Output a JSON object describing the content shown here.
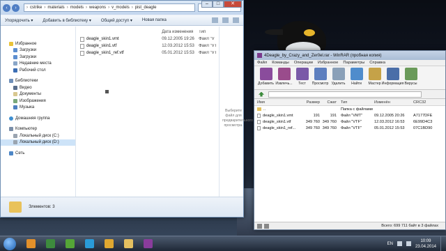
{
  "explorer": {
    "breadcrumb": [
      "cstrike",
      "materials",
      "models",
      "weapons",
      "v_models",
      "pist_deagle"
    ],
    "search_placeholder": "",
    "toolbar": [
      "Упорядочить ▾",
      "Добавить в библиотеку ▾",
      "Общий доступ ▾",
      "Новая папка"
    ],
    "sidebar": {
      "favorites": {
        "label": "Избранное",
        "items": [
          "Загрузки",
          "Загрузки",
          "Недавние места",
          "Рабочий стол"
        ]
      },
      "libraries": {
        "label": "Библиотеки",
        "items": [
          "Видео",
          "Документы",
          "Изображения",
          "Музыка"
        ]
      },
      "homegroup": "Домашняя группа",
      "computer": {
        "label": "Компьютер",
        "items": [
          "Локальный диск (C:)",
          "Локальный диск (D:)"
        ]
      },
      "network": "Сеть"
    },
    "files": [
      {
        "name": "deagle_skin1.vmt",
        "date": "09.12.2005 19:26",
        "type": "Файл \"V"
      },
      {
        "name": "deagle_skin1.vtf",
        "date": "12.03.2012 15:53",
        "type": "Файл \"VT"
      },
      {
        "name": "deagle_skin1_ref.vtf",
        "date": "05.01.2012 15:53",
        "type": "Файл \"VT"
      }
    ],
    "columns": {
      "date": "Дата изменения",
      "type": "Тип"
    },
    "preview_text": "Выберите файл для предварительного просмотра.",
    "status": "Элементов: 3"
  },
  "winrar": {
    "title": "4Deagle_by_Crazy_and_Zer0el.rar - WinRAR (пробная копия)",
    "menu": [
      "Файл",
      "Команды",
      "Операции",
      "Избранное",
      "Параметры",
      "Справка"
    ],
    "tools": [
      {
        "label": "Добавить",
        "color": "#8a4c9c"
      },
      {
        "label": "Извлечь...",
        "color": "#9a4c8c"
      },
      {
        "label": "Тест",
        "color": "#7a5aa8"
      },
      {
        "label": "Просмотр",
        "color": "#5d7fbf"
      },
      {
        "label": "Удалить",
        "color": "#8aa0b8"
      },
      {
        "label": "Найти",
        "color": "#4f8ccc"
      },
      {
        "label": "Мастер",
        "color": "#c5a248"
      },
      {
        "label": "Информация",
        "color": "#4a6ea8"
      },
      {
        "label": "Вирусы",
        "color": "#6a9a5a"
      }
    ],
    "columns": [
      "Имя",
      "Размер",
      "Сжат",
      "Тип",
      "Изменён",
      "CRC32"
    ],
    "rows": [
      {
        "name": "..",
        "size": "",
        "packed": "",
        "type": "Папка с файлами",
        "modified": "",
        "crc": ""
      },
      {
        "name": "deagle_skin1.vmt",
        "size": "191",
        "packed": "191",
        "type": "Файл \"VMT\"",
        "modified": "09.12.2005 20:26",
        "crc": "A7177DFE"
      },
      {
        "name": "deagle_skin1.vtf",
        "size": "349 760",
        "packed": "349 760",
        "type": "Файл \"VTF\"",
        "modified": "12.03.2012 16:53",
        "crc": "6E99D4C3"
      },
      {
        "name": "deagle_skin1_ref...",
        "size": "349 760",
        "packed": "349 760",
        "type": "Файл \"VTF\"",
        "modified": "05.01.2012 15:53",
        "crc": "07C1BD90"
      }
    ],
    "status": "Всего: 699 711 байт в 3 файлах"
  },
  "taskbar": {
    "apps": [
      {
        "name": "half-life-icon",
        "color": "#e3902a"
      },
      {
        "name": "game-icon",
        "color": "#3d8b3d"
      },
      {
        "name": "utorrent-icon",
        "color": "#55a637"
      },
      {
        "name": "skype-icon",
        "color": "#2a9bd8"
      },
      {
        "name": "photo-icon",
        "color": "#e0a830"
      },
      {
        "name": "folder-icon",
        "color": "#e5c060"
      },
      {
        "name": "winrar-icon",
        "color": "#8a3c9c"
      }
    ],
    "lang": "EN",
    "time": "10:09",
    "date": "23.04.2014"
  }
}
